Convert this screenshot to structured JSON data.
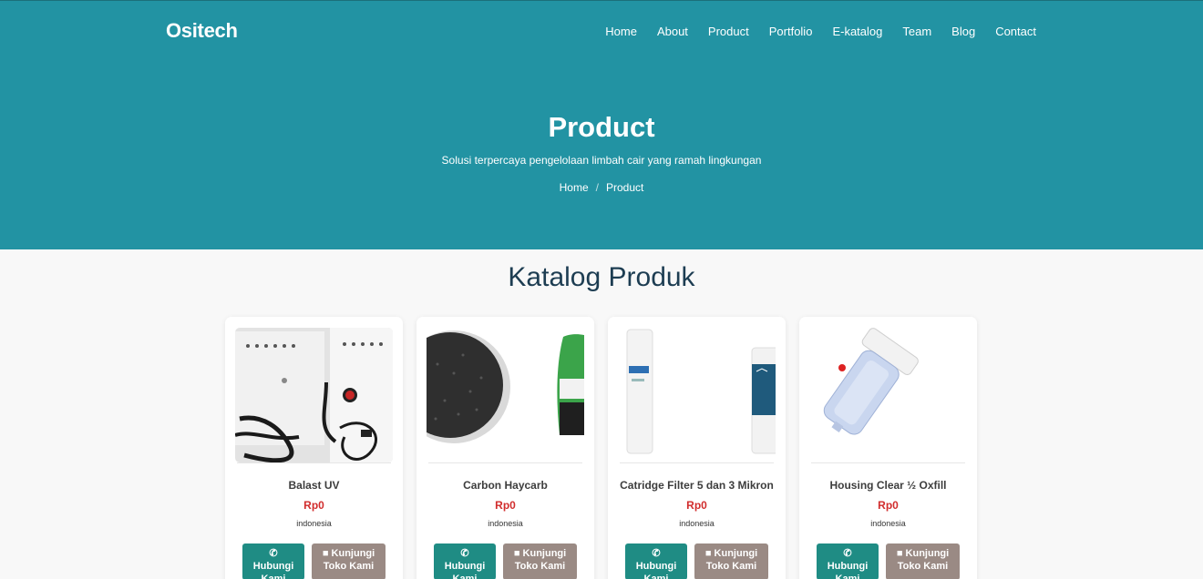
{
  "header": {
    "brand": "Ositech",
    "nav": [
      "Home",
      "About",
      "Product",
      "Portfolio",
      "E-katalog",
      "Team",
      "Blog",
      "Contact"
    ]
  },
  "hero": {
    "title": "Product",
    "subtitle": "Solusi terpercaya pengelolaan limbah cair yang ramah lingkungan",
    "breadcrumb": [
      "Home",
      "Product"
    ]
  },
  "catalog": {
    "title": "Katalog Produk",
    "products": [
      {
        "name": "Balast UV",
        "price": "Rp0",
        "origin": "indonesia",
        "contact_label": "Hubungi Kami",
        "visit_label": "Kunjungi Toko Kami"
      },
      {
        "name": "Carbon Haycarb",
        "price": "Rp0",
        "origin": "indonesia",
        "contact_label": "Hubungi Kami",
        "visit_label": "Kunjungi Toko Kami"
      },
      {
        "name": "Catridge Filter 5 dan 3 Mikron",
        "price": "Rp0",
        "origin": "indonesia",
        "contact_label": "Hubungi Kami",
        "visit_label": "Kunjungi Toko Kami"
      },
      {
        "name": "Housing Clear ½ Oxfill",
        "price": "Rp0",
        "origin": "indonesia",
        "contact_label": "Hubungi Kami",
        "visit_label": "Kunjungi Toko Kami"
      }
    ]
  },
  "icons": {
    "contact": "phone-icon",
    "visit": "shopping-bag-icon"
  },
  "colors": {
    "hero": "#2293a3",
    "contact_button": "#1f8c84",
    "visit_button": "#9a8a84",
    "price": "#d12d2d"
  }
}
